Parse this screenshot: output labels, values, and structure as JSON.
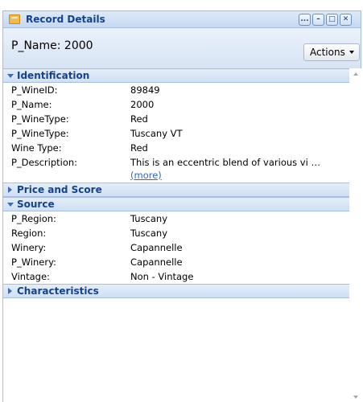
{
  "window": {
    "title": "Record Details",
    "buttons": {
      "more": "...",
      "minimize": "–",
      "maximize": "□",
      "close": "✕"
    }
  },
  "header": {
    "record_name": "P_Name: 2000",
    "actions_label": "Actions"
  },
  "sections": {
    "identification": {
      "title": "Identification",
      "expanded": true,
      "fields": [
        {
          "key": "P_WineID:",
          "value": "89849"
        },
        {
          "key": "P_Name:",
          "value": "2000"
        },
        {
          "key": "P_WineType:",
          "value": "Red"
        },
        {
          "key": "P_WineType:",
          "value": "Tuscany VT"
        },
        {
          "key": "Wine Type:",
          "value": "Red"
        },
        {
          "key": "P_Description:",
          "value": "This is an eccentric blend of various vi …",
          "more": "(more)"
        }
      ]
    },
    "price_and_score": {
      "title": "Price and Score",
      "expanded": false
    },
    "source": {
      "title": "Source",
      "expanded": true,
      "fields": [
        {
          "key": "P_Region:",
          "value": "Tuscany"
        },
        {
          "key": "Region:",
          "value": "Tuscany"
        },
        {
          "key": "Winery:",
          "value": "Capannelle"
        },
        {
          "key": "P_Winery:",
          "value": "Capannelle"
        },
        {
          "key": "Vintage:",
          "value": "Non - Vintage"
        }
      ]
    },
    "characteristics": {
      "title": "Characteristics",
      "expanded": false
    }
  },
  "colors": {
    "title_text": "#15428b",
    "section_bg": "#d6e3f4",
    "link": "#3366cc"
  },
  "icons": {
    "title": "record-icon",
    "expanded": "triangle-down-icon",
    "collapsed": "triangle-right-icon"
  }
}
